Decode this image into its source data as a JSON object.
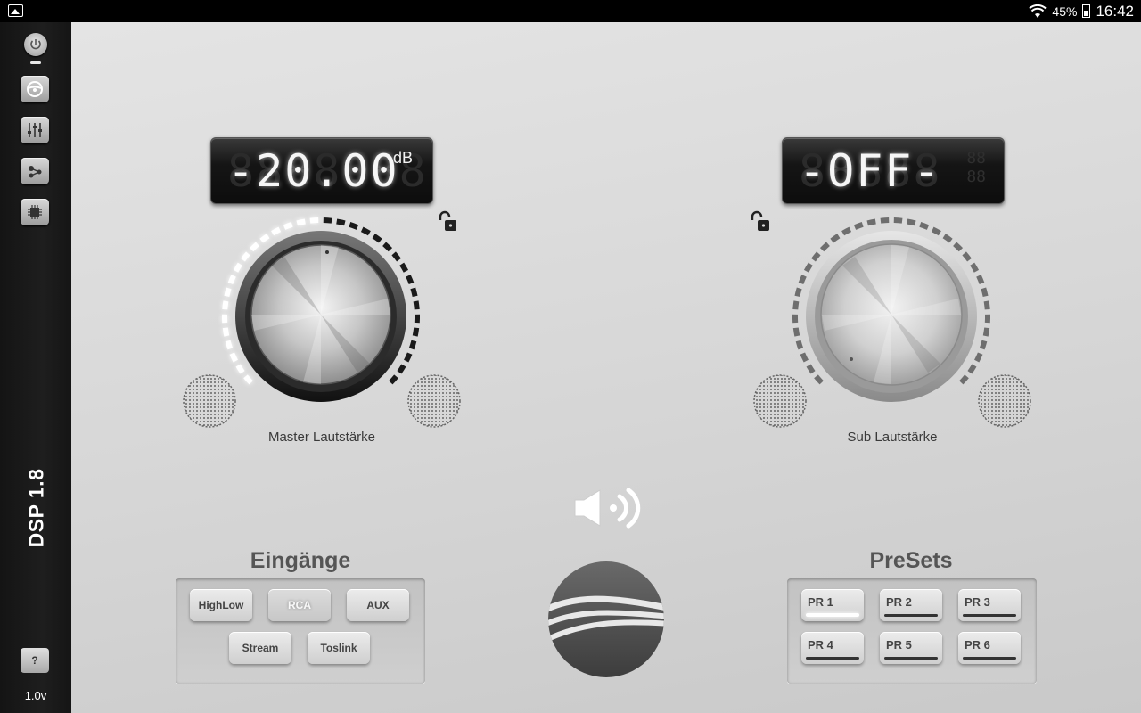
{
  "status_bar": {
    "wifi": "wifi-icon",
    "battery_percent": "45%",
    "time": "16:42"
  },
  "sidebar": {
    "items": [
      {
        "name": "power",
        "icon": "power-icon"
      },
      {
        "name": "steering",
        "icon": "steering-wheel-icon"
      },
      {
        "name": "equalizer",
        "icon": "sliders-icon"
      },
      {
        "name": "routing",
        "icon": "share-nodes-icon"
      },
      {
        "name": "chip",
        "icon": "chip-icon"
      }
    ],
    "product": "DSP 1.8",
    "help_label": "?",
    "version": "1.0v"
  },
  "master": {
    "display_value": "-20.00",
    "unit": "dB",
    "label": "Master Lautstärke",
    "level_fraction": 0.5,
    "locked": false
  },
  "sub": {
    "display_value": "-OFF-",
    "label": "Sub Lautstärke",
    "level_fraction": 0.0,
    "locked": false
  },
  "inputs": {
    "title": "Eingänge",
    "buttons": [
      {
        "label": "HighLow",
        "active": false
      },
      {
        "label": "RCA",
        "active": true
      },
      {
        "label": "AUX",
        "active": false
      },
      {
        "label": "Stream",
        "active": false
      },
      {
        "label": "Toslink",
        "active": false
      }
    ]
  },
  "presets": {
    "title": "PreSets",
    "buttons": [
      {
        "label": "PR 1",
        "active": true
      },
      {
        "label": "PR 2",
        "active": false
      },
      {
        "label": "PR 3",
        "active": false
      },
      {
        "label": "PR 4",
        "active": false
      },
      {
        "label": "PR 5",
        "active": false
      },
      {
        "label": "PR 6",
        "active": false
      }
    ]
  },
  "colors": {
    "accent": "#ffffff",
    "panel": "#d6d6d6",
    "display_bg": "#111111"
  }
}
